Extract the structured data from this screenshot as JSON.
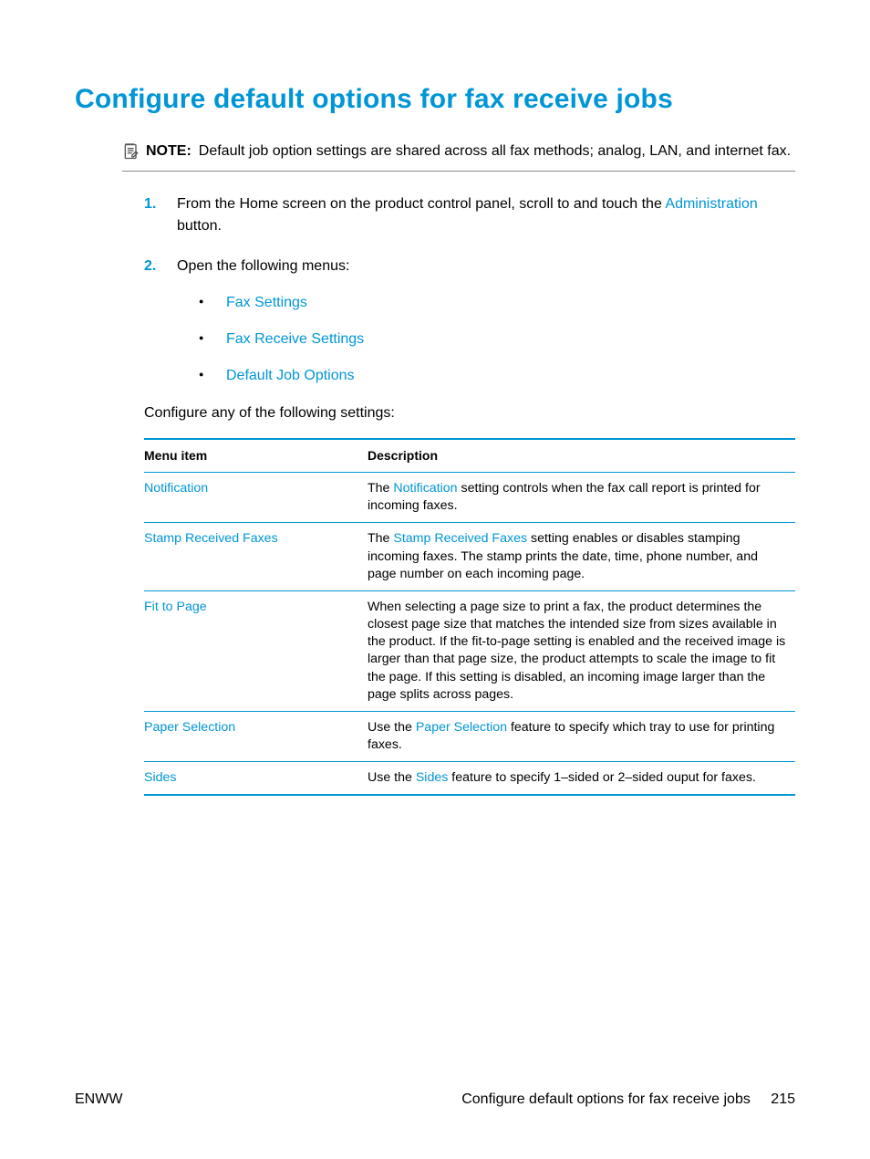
{
  "title": "Configure default options for fax receive jobs",
  "note": {
    "label": "NOTE:",
    "text_before": "Default job option settings are shared across all fax methods; analog, LAN, and internet fax."
  },
  "steps": {
    "s1_before": "From the Home screen on the product control panel, scroll to and touch the ",
    "s1_link": "Administration",
    "s1_after": " button.",
    "s2": "Open the following menus:",
    "bullets": [
      "Fax Settings",
      "Fax Receive Settings",
      "Default Job Options"
    ]
  },
  "intro": "Configure any of the following settings:",
  "table": {
    "headers": [
      "Menu item",
      "Description"
    ],
    "rows": [
      {
        "item": "Notification",
        "desc_pre": "The ",
        "desc_link": "Notification",
        "desc_post": " setting controls when the fax call report is printed for incoming faxes."
      },
      {
        "item": "Stamp Received Faxes",
        "desc_pre": "The ",
        "desc_link": "Stamp Received Faxes",
        "desc_post": " setting enables or disables stamping incoming faxes. The stamp prints the date, time, phone number, and page number on each incoming page."
      },
      {
        "item": "Fit to Page",
        "desc_pre": "",
        "desc_link": "",
        "desc_post": "When selecting a page size to print a fax, the product determines the closest page size that matches the intended size from sizes available in the product. If the fit-to-page setting is enabled and the received image is larger than that page size, the product attempts to scale the image to fit the page. If this setting is disabled, an incoming image larger than the page splits across pages."
      },
      {
        "item": "Paper Selection",
        "desc_pre": "Use the ",
        "desc_link": "Paper Selection",
        "desc_post": " feature to specify which tray to use for printing faxes."
      },
      {
        "item": "Sides",
        "desc_pre": "Use the ",
        "desc_link": "Sides",
        "desc_post": " feature to specify 1–sided or 2–sided ouput for faxes."
      }
    ]
  },
  "footer": {
    "left": "ENWW",
    "right_text": "Configure default options for fax receive jobs",
    "page": "215"
  }
}
